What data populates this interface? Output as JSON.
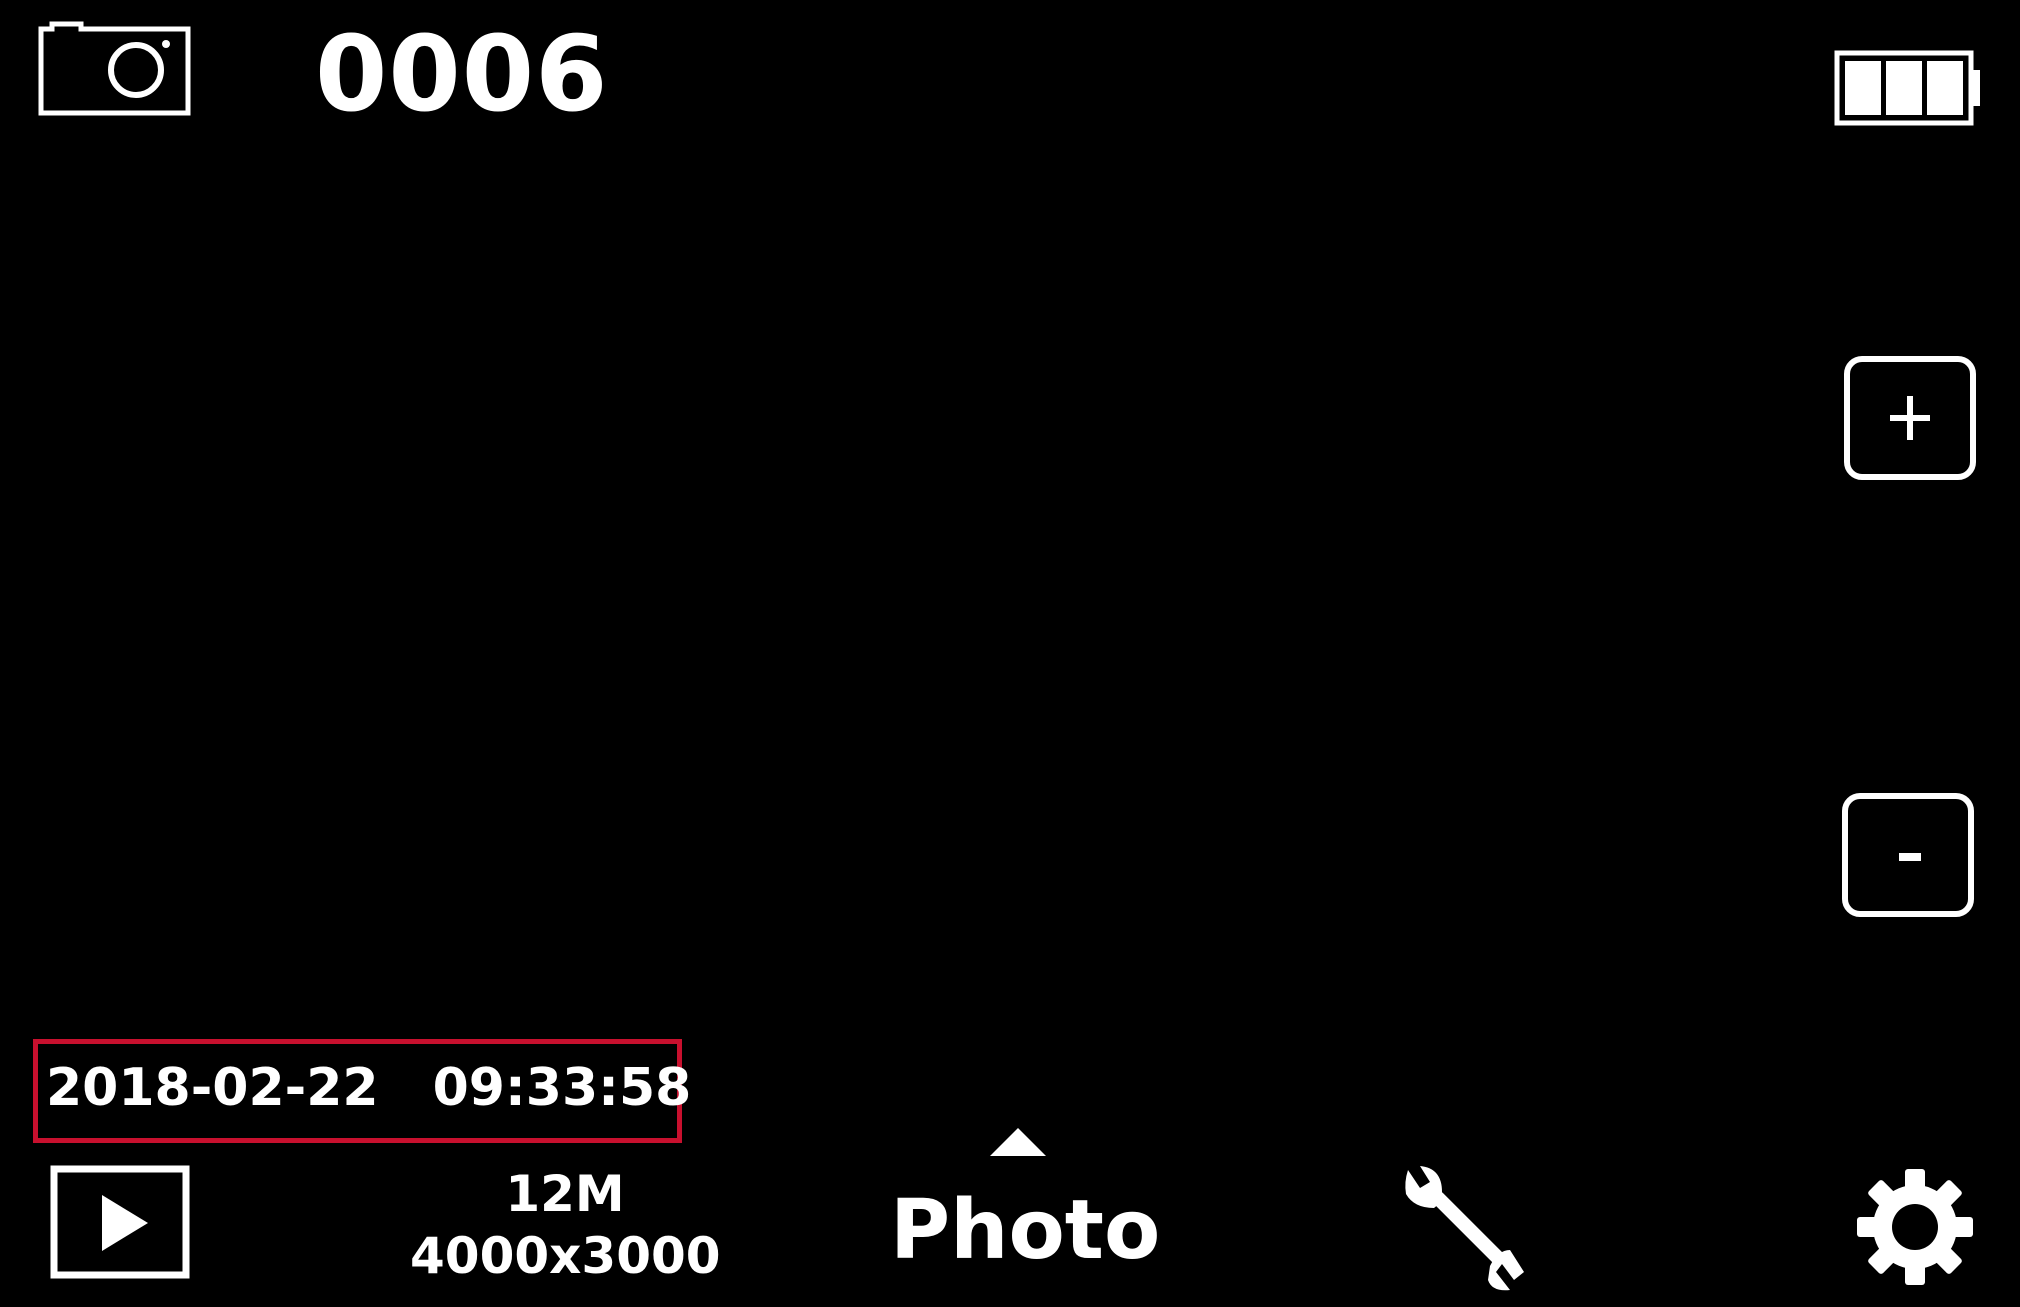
{
  "status": {
    "shot_count": "0006",
    "mode_icon": "camera-icon",
    "battery_icon": "battery-full-icon"
  },
  "info": {
    "date": "2018-02-22",
    "time": "09:33:58",
    "highlight_color": "#c8102e"
  },
  "resolution": {
    "megapixels": "12M",
    "dimensions": "4000x3000"
  },
  "mode": {
    "label": "Photo",
    "indicator_icon": "caret-up-icon"
  },
  "zoom": {
    "in_icon": "plus-icon",
    "out_icon": "minus-icon"
  },
  "toolbar": {
    "playback_icon": "play-icon",
    "tools_icon": "wrench-icon",
    "settings_icon": "gear-icon"
  }
}
